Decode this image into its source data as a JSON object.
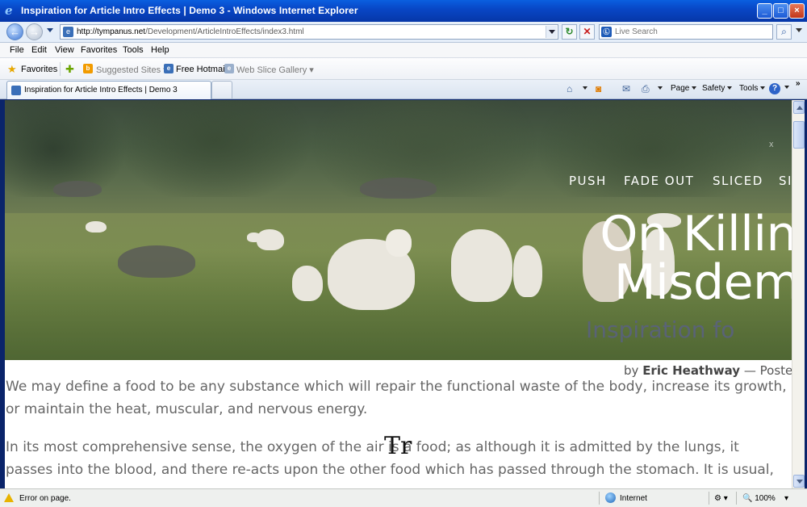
{
  "window": {
    "title": "Inspiration for Article Intro Effects | Demo 3 - Windows Internet Explorer",
    "icon": "ie-logo-icon"
  },
  "address": {
    "url_host": "http://tympanus.net",
    "url_path": "/Development/ArticleIntroEffects/index3.html",
    "search_placeholder": "Live Search"
  },
  "menu": [
    "File",
    "Edit",
    "View",
    "Favorites",
    "Tools",
    "Help"
  ],
  "favorites_bar": {
    "favorites_label": "Favorites",
    "suggested_sites": "Suggested Sites",
    "free_hotmail": "Free Hotmail",
    "web_slice_gallery": "Web Slice Gallery"
  },
  "tab": {
    "label": "Inspiration for Article Intro Effects | Demo 3"
  },
  "command_bar": {
    "page": "Page",
    "safety": "Safety",
    "tools": "Tools"
  },
  "page": {
    "nav": [
      "PUSH",
      "FADE OUT",
      "SLICED",
      "SI"
    ],
    "close_mark": "x",
    "title_line1": "On Killing Anin",
    "title_line2": "Misdem",
    "subtitle": "Inspiration fo",
    "byline_prefix": "by",
    "author": "Eric Heathway",
    "byline_suffix": "— Poste",
    "paragraph1": "We may define a food to be any substance which will repair the functional waste of the body, increase its growth, or maintain the heat, muscular, and nervous energy.",
    "paragraph2": "In its most comprehensive sense, the oxygen of the air is a food; as although it is admitted by the lungs, it passes into the blood, and there re-acts upon the other food which has passed through the stomach. It is usual,",
    "cursor_glyph": "Tr"
  },
  "status": {
    "message": "Error on page.",
    "zone": "Internet",
    "zoom": "100%"
  },
  "colors": {
    "titlebar": "#0847c6",
    "body_text": "#666666",
    "hero_text": "#ffffff"
  }
}
